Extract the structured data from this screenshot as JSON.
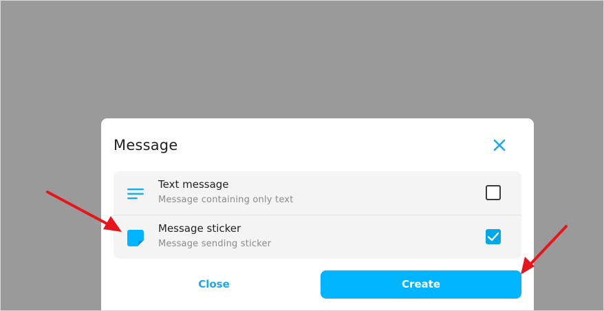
{
  "modal": {
    "title": "Message",
    "close_icon": "close-icon",
    "options": [
      {
        "title": "Text message",
        "subtitle": "Message containing only text",
        "icon": "text-lines-icon",
        "checked": false
      },
      {
        "title": "Message sticker",
        "subtitle": "Message sending sticker",
        "icon": "sticker-icon",
        "checked": true
      }
    ],
    "close_label": "Close",
    "create_label": "Create"
  },
  "colors": {
    "accent": "#00b4ff",
    "link": "#1aa9ea",
    "checkbox_checked": "#00a8e8",
    "overlay": "#9a9a9a",
    "annotation_arrow": "#e8141b"
  }
}
